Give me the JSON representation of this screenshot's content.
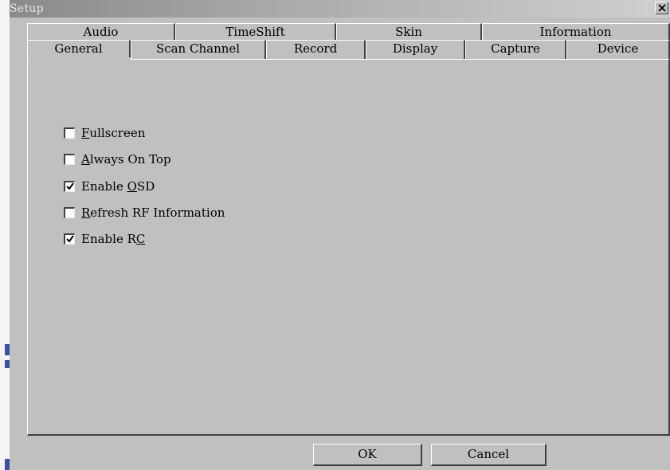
{
  "window": {
    "title": "Setup",
    "close_label": "X"
  },
  "tabs": {
    "back_row": [
      {
        "label": "Audio"
      },
      {
        "label": "TimeShift"
      },
      {
        "label": "Skin"
      },
      {
        "label": "Information"
      }
    ],
    "front_row": [
      {
        "label": "General",
        "active": true
      },
      {
        "label": "Scan Channel"
      },
      {
        "label": "Record"
      },
      {
        "label": "Display"
      },
      {
        "label": "Capture"
      },
      {
        "label": "Device"
      }
    ]
  },
  "general": {
    "options": [
      {
        "pre": "",
        "key": "F",
        "post": "ullscreen",
        "checked": false
      },
      {
        "pre": "",
        "key": "A",
        "post": "lways On Top",
        "checked": false
      },
      {
        "pre": "Enable ",
        "key": "O",
        "post": "SD",
        "checked": true
      },
      {
        "pre": "",
        "key": "R",
        "post": "efresh RF Information",
        "checked": false
      },
      {
        "pre": "Enable R",
        "key": "C",
        "post": "",
        "checked": true
      }
    ]
  },
  "buttons": {
    "ok_label": "OK",
    "cancel_label": "Cancel"
  }
}
